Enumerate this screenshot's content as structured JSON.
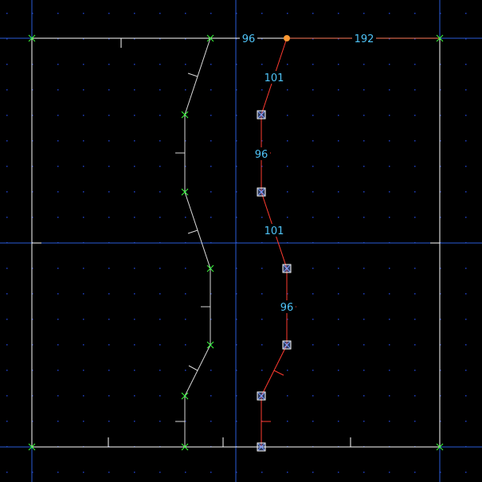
{
  "editor": {
    "colors": {
      "background": "#000000",
      "grid_dot": "#1f3fbf",
      "axis": "#2a5bd7",
      "sector_line": "#ffffff",
      "other_linedef": "#d8d8d8",
      "selected_linedef": "#ff3b30",
      "vertex_marker": "#3cff3c",
      "selected_vertex": "#ffffff",
      "selected_vertex_fill": "#7fa0ff",
      "highlight_vertex": "#ff9933",
      "label": "#4fc3f7"
    },
    "labels": {
      "top_left_length": "96",
      "top_right_length": "192",
      "seg1_length": "101",
      "seg2_length": "96",
      "seg3_length": "101",
      "seg4_length": "96"
    }
  }
}
